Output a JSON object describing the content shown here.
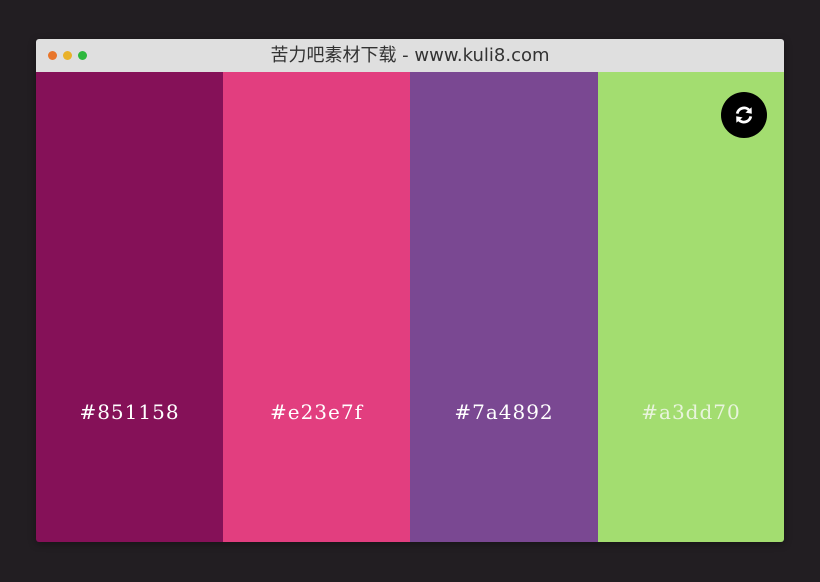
{
  "window": {
    "title": "苦力吧素材下载 - www.kuli8.com",
    "traffic_lights": [
      "#e8762b",
      "#e9b22a",
      "#2db83d"
    ]
  },
  "palette": {
    "swatches": [
      {
        "color": "#851158",
        "label": "#851158",
        "text_color": "#ffffff"
      },
      {
        "color": "#e23e7f",
        "label": "#e23e7f",
        "text_color": "#ffffff"
      },
      {
        "color": "#7a4892",
        "label": "#7a4892",
        "text_color": "#ffffff"
      },
      {
        "color": "#a3dd70",
        "label": "#a3dd70",
        "text_color": "#e8f4dc"
      }
    ]
  },
  "refresh_button": {
    "icon": "refresh-icon",
    "background": "#000000"
  }
}
